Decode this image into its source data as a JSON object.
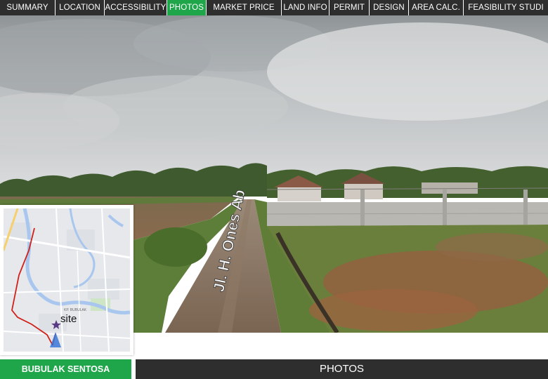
{
  "nav": {
    "tabs": [
      {
        "label": "SUMMARY",
        "active": false
      },
      {
        "label": "LOCATION",
        "active": false
      },
      {
        "label": "ACCESSIBILITY",
        "active": false
      },
      {
        "label": "PHOTOS",
        "active": true
      },
      {
        "label": "MARKET PRICE",
        "active": false
      },
      {
        "label": "LAND INFO",
        "active": false
      },
      {
        "label": "PERMIT",
        "active": false
      },
      {
        "label": "DESIGN",
        "active": false
      },
      {
        "label": "AREA CALC.",
        "active": false
      },
      {
        "label": "FEASIBILITY  STUDI",
        "active": false
      }
    ]
  },
  "photo": {
    "street_sign": "Jl. H. Ones Ab",
    "map_inset": {
      "site_label": "site",
      "area_label": "KP. BUBULAK"
    }
  },
  "footer": {
    "project_name": "BUBULAK SENTOSA",
    "section_title": "PHOTOS"
  },
  "colors": {
    "accent_green": "#1fa64a",
    "bar_dark": "#2e2e2e",
    "route_red": "#d0201a"
  }
}
